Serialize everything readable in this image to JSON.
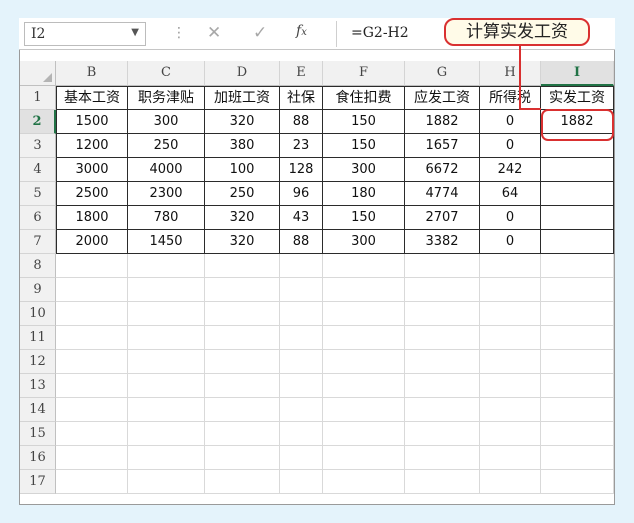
{
  "name_box": {
    "value": "I2"
  },
  "formula_bar": {
    "formula": "=G2-H2"
  },
  "callout": {
    "text": "计算实发工资"
  },
  "grid": {
    "active_cell": "I2",
    "columns": [
      "B",
      "C",
      "D",
      "E",
      "F",
      "G",
      "H",
      "I"
    ],
    "rows": [
      "1",
      "2",
      "3",
      "4",
      "5",
      "6",
      "7",
      "8",
      "9",
      "10",
      "11",
      "12",
      "13",
      "14",
      "15",
      "16",
      "17"
    ],
    "headers": [
      "基本工资",
      "职务津贴",
      "加班工资",
      "社保",
      "食住扣费",
      "应发工资",
      "所得税",
      "实发工资"
    ],
    "data": [
      [
        "1500",
        "300",
        "320",
        "88",
        "150",
        "1882",
        "0",
        "1882"
      ],
      [
        "1200",
        "250",
        "380",
        "23",
        "150",
        "1657",
        "0",
        ""
      ],
      [
        "3000",
        "4000",
        "100",
        "128",
        "300",
        "6672",
        "242",
        ""
      ],
      [
        "2500",
        "2300",
        "250",
        "96",
        "180",
        "4774",
        "64",
        ""
      ],
      [
        "1800",
        "780",
        "320",
        "43",
        "150",
        "2707",
        "0",
        ""
      ],
      [
        "2000",
        "1450",
        "320",
        "88",
        "300",
        "3382",
        "0",
        ""
      ]
    ]
  },
  "icons": {
    "dropdown": "chevron-down-icon",
    "cancel": "close-icon",
    "confirm": "check-icon",
    "function": "fx-icon"
  },
  "colors": {
    "accent_red": "#d93030",
    "active_green": "#217346",
    "page_bg": "#e4f3fb"
  }
}
